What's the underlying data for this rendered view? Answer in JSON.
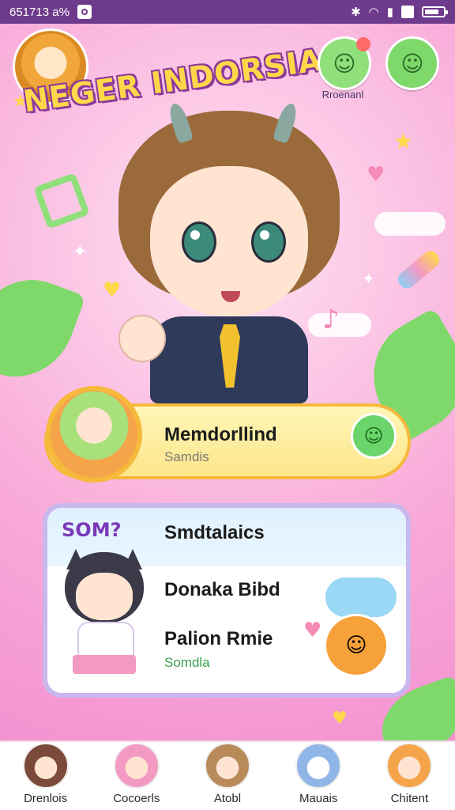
{
  "status_bar": {
    "left_text": "651713 a%"
  },
  "header": {
    "logo_title": "NEGER INDORSIA",
    "round_button_label": "Rroenanl"
  },
  "card_featured": {
    "title": "Memdorllind",
    "subtitle": "Samdis"
  },
  "card_list": {
    "badge": "SOM?",
    "heading": "Smdtalaics",
    "line1": "Donaka Bibd",
    "line2": "Palion Rmie",
    "sub": "Somdla"
  },
  "bottom_nav": {
    "items": [
      {
        "label": "Drenlois",
        "avatar_color": "#7b4a3a"
      },
      {
        "label": "Cocoerls",
        "avatar_color": "#f39ac3"
      },
      {
        "label": "Atobl",
        "avatar_color": "#b98a5a"
      },
      {
        "label": "Mauais",
        "avatar_color": "#8fb6e6"
      },
      {
        "label": "Chitent",
        "avatar_color": "#f5a44a"
      }
    ]
  },
  "colors": {
    "status_bar": "#6e3b8c",
    "background": "#f8a9d8",
    "card_featured_border": "#f6b93b",
    "card_list_border": "#c8b8ee",
    "accent_green": "#7fd96a"
  }
}
